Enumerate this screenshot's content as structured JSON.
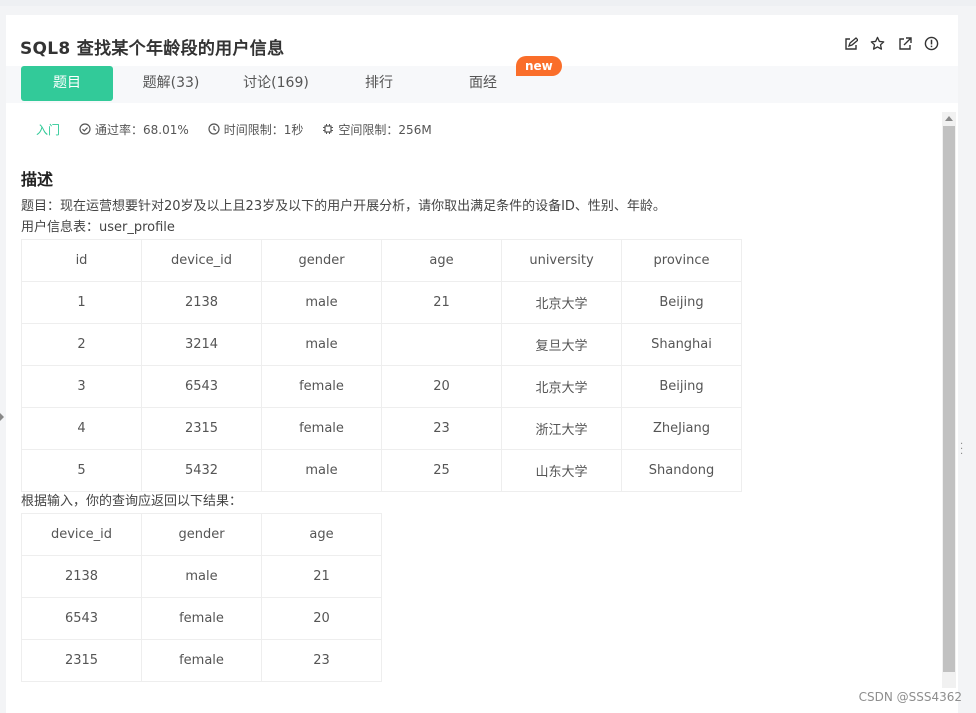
{
  "problem": {
    "title": "SQL8  查找某个年龄段的用户信息"
  },
  "tabs": [
    {
      "label": "题目"
    },
    {
      "label": "题解(33)"
    },
    {
      "label": "讨论(169)"
    },
    {
      "label": "排行"
    },
    {
      "label": "面经"
    }
  ],
  "new_badge": "new",
  "meta": {
    "level": "入门",
    "pass_rate": "通过率：68.01%",
    "time_limit": "时间限制：1秒",
    "space_limit": "空间限制：256M"
  },
  "description": {
    "heading": "描述",
    "line1": "题目：现在运营想要针对20岁及以上且23岁及以下的用户开展分析，请你取出满足条件的设备ID、性别、年龄。",
    "line2": "用户信息表：user_profile",
    "result_intro": "根据输入，你的查询应返回以下结果："
  },
  "user_table": {
    "headers": [
      "id",
      "device_id",
      "gender",
      "age",
      "university",
      "province"
    ],
    "rows": [
      [
        "1",
        "2138",
        "male",
        "21",
        "北京大学",
        "Beijing"
      ],
      [
        "2",
        "3214",
        "male",
        "",
        "复旦大学",
        "Shanghai"
      ],
      [
        "3",
        "6543",
        "female",
        "20",
        "北京大学",
        "Beijing"
      ],
      [
        "4",
        "2315",
        "female",
        "23",
        "浙江大学",
        "ZheJiang"
      ],
      [
        "5",
        "5432",
        "male",
        "25",
        "山东大学",
        "Shandong"
      ]
    ]
  },
  "result_table": {
    "headers": [
      "device_id",
      "gender",
      "age"
    ],
    "rows": [
      [
        "2138",
        "male",
        "21"
      ],
      [
        "6543",
        "female",
        "20"
      ],
      [
        "2315",
        "female",
        "23"
      ]
    ]
  },
  "watermark": "CSDN @SSS4362",
  "colors": {
    "accent": "#32ca99",
    "badge": "#fa6e2a"
  }
}
